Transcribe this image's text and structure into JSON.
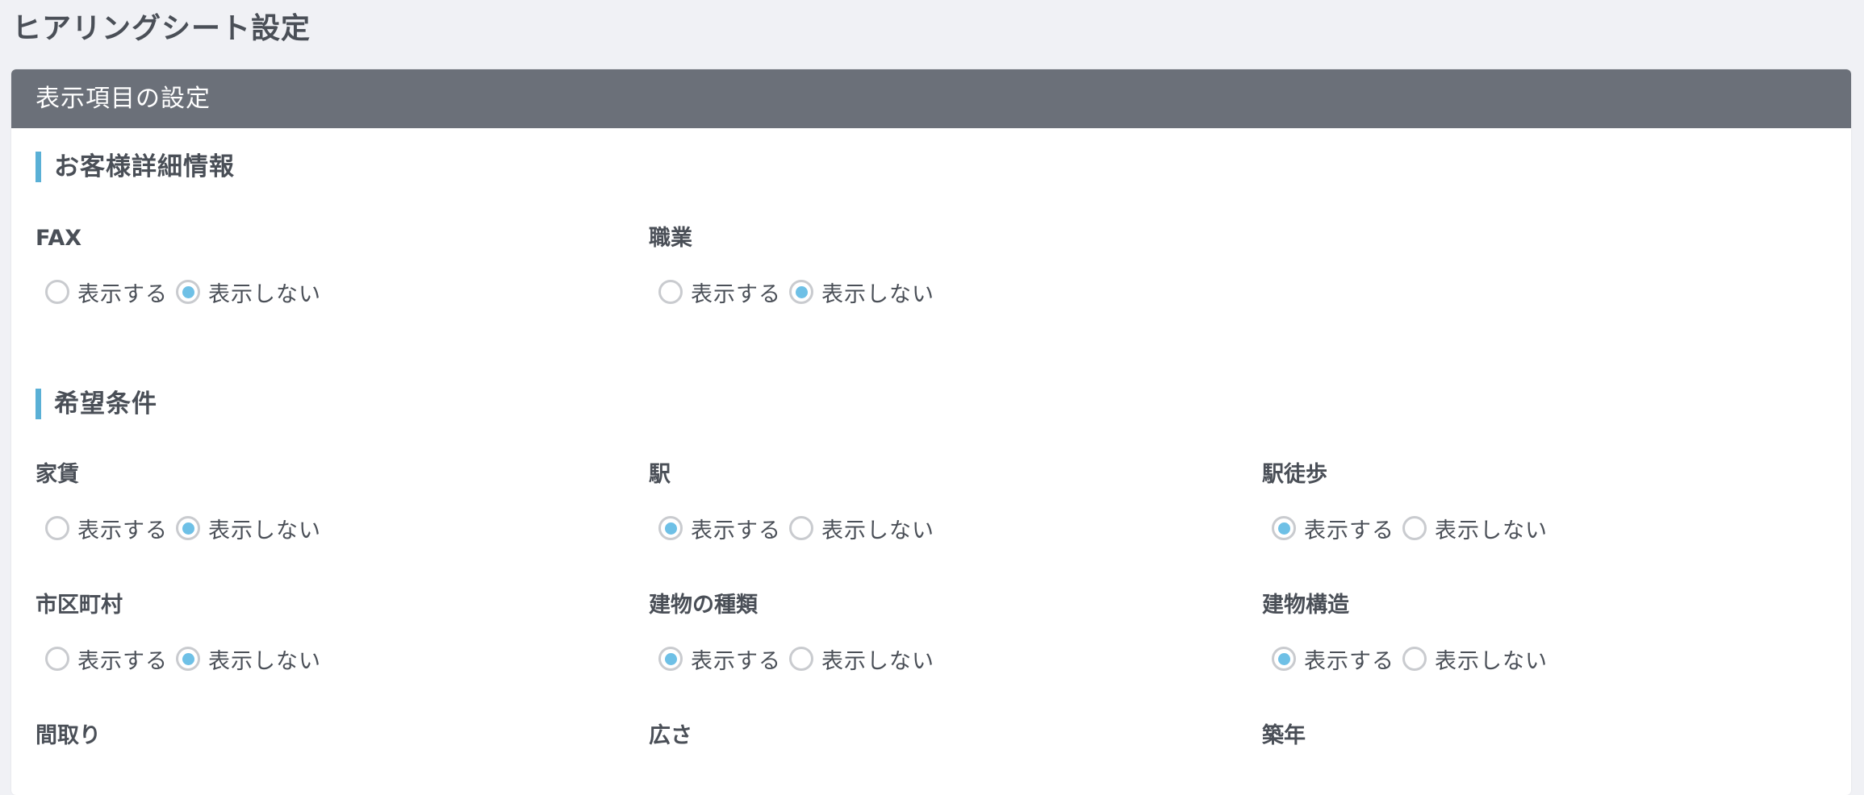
{
  "page": {
    "title": "ヒアリングシート設定"
  },
  "panel": {
    "header": "表示項目の設定"
  },
  "options": {
    "show": "表示する",
    "hide": "表示しない"
  },
  "accent_color": "#5ab0d6",
  "sections": [
    {
      "title": "お客様詳細情報",
      "fields": [
        {
          "label": "FAX",
          "selected": "hide"
        },
        {
          "label": "職業",
          "selected": "hide"
        }
      ]
    },
    {
      "title": "希望条件",
      "fields": [
        {
          "label": "家賃",
          "selected": "hide"
        },
        {
          "label": "駅",
          "selected": "show"
        },
        {
          "label": "駅徒歩",
          "selected": "show"
        },
        {
          "label": "市区町村",
          "selected": "hide"
        },
        {
          "label": "建物の種類",
          "selected": "show"
        },
        {
          "label": "建物構造",
          "selected": "show"
        },
        {
          "label": "間取り"
        },
        {
          "label": "広さ"
        },
        {
          "label": "築年"
        }
      ]
    }
  ]
}
